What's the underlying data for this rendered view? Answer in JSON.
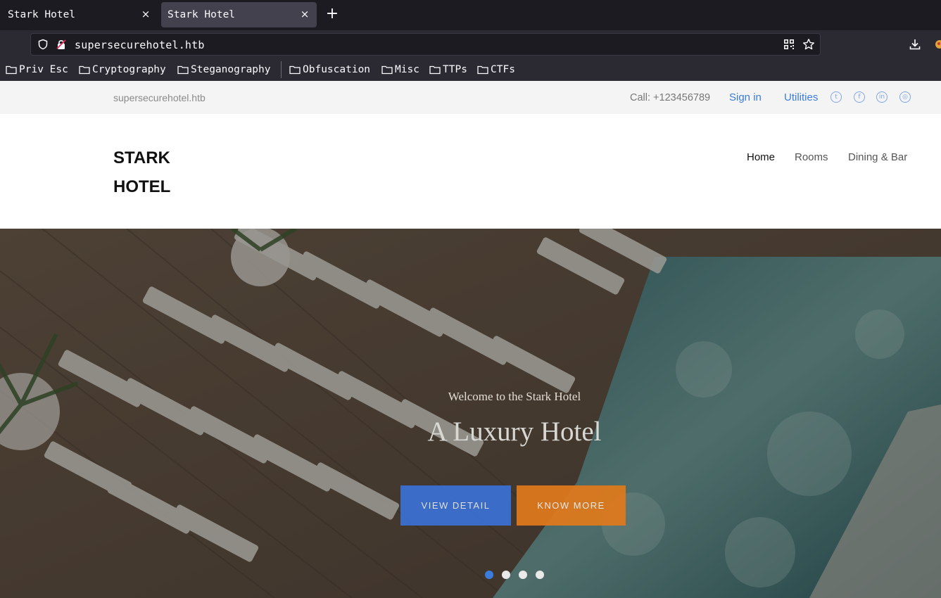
{
  "browser": {
    "tabs": [
      {
        "title": "Stark Hotel",
        "active": false
      },
      {
        "title": "Stark Hotel",
        "active": true
      }
    ],
    "close_glyph": "×",
    "new_tab_glyph": "+",
    "url": "supersecurehotel.htb",
    "bookmarks": [
      "Priv Esc",
      "Cryptography",
      "Steganography",
      "Obfuscation",
      "Misc",
      "TTPs",
      "CTFs"
    ],
    "icons": {
      "shield": "shield-icon",
      "lock": "lock-icon",
      "qr": "qr-code-icon",
      "star": "bookmark-star-icon",
      "download": "download-icon",
      "extension": "extension-icon",
      "folder": "folder-icon"
    }
  },
  "site": {
    "topbar": {
      "domain": "supersecurehotel.htb",
      "call": "Call: +123456789",
      "sign_in": "Sign in",
      "utilities": "Utilities",
      "social_icons": [
        "twitter-icon",
        "facebook-icon",
        "linkedin-icon",
        "dribbble-icon"
      ]
    },
    "logo": "STARK HOTEL",
    "nav": [
      {
        "label": "Home",
        "active": true
      },
      {
        "label": "Rooms",
        "active": false
      },
      {
        "label": "Dining & Bar",
        "active": false
      }
    ],
    "hero": {
      "subtitle": "Welcome to the Stark Hotel",
      "title": "A Luxury Hotel",
      "buttons": {
        "view_detail": "VIEW DETAIL",
        "know_more": "KNOW MORE"
      },
      "slides": 4,
      "active_slide": 1
    }
  },
  "colors": {
    "link": "#3b7ddd",
    "btn_blue": "#3b72d8",
    "btn_orange": "#e07a1c",
    "chrome_dark": "#1c1b22",
    "chrome": "#2b2a33"
  }
}
